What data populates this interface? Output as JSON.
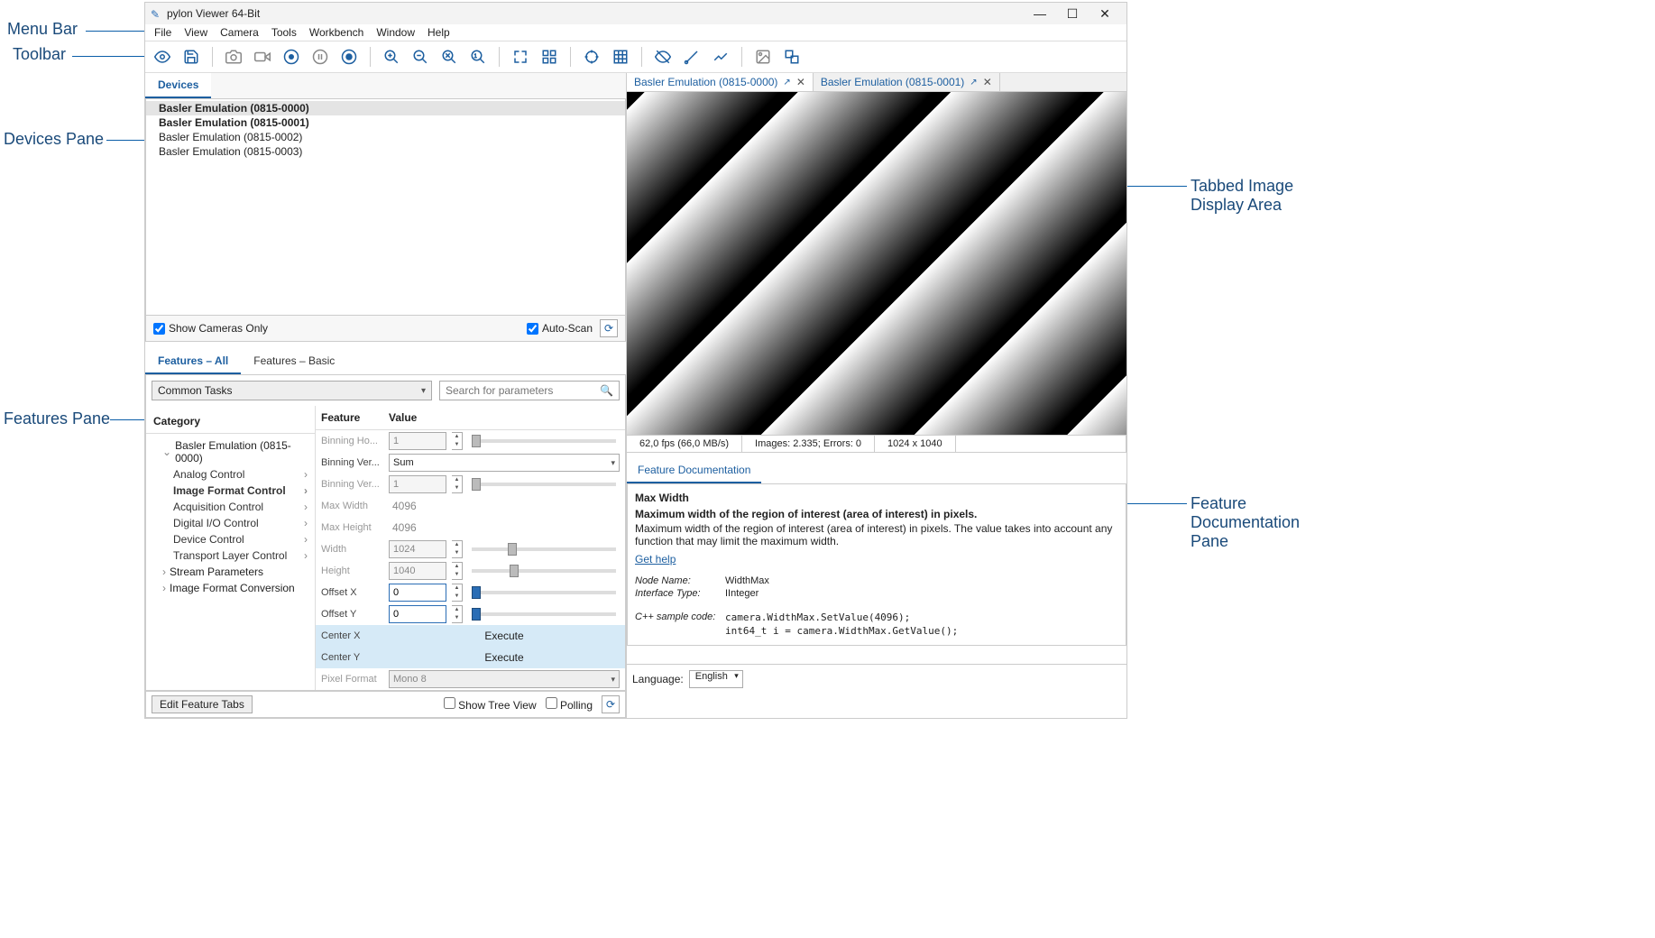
{
  "annotations": {
    "menu_bar": "Menu Bar",
    "toolbar": "Toolbar",
    "devices_pane": "Devices Pane",
    "features_pane": "Features Pane",
    "image_area": "Tabbed Image Display Area",
    "doc_pane": "Feature Documentation Pane"
  },
  "titlebar": {
    "title": "pylon Viewer 64-Bit"
  },
  "menus": {
    "file": "File",
    "view": "View",
    "camera": "Camera",
    "tools": "Tools",
    "workbench": "Workbench",
    "window": "Window",
    "help": "Help"
  },
  "devices": {
    "tab": "Devices",
    "items": [
      {
        "label": "Basler Emulation (0815-0000)",
        "bold": true,
        "selected": true
      },
      {
        "label": "Basler Emulation (0815-0001)",
        "bold": true,
        "selected": false
      },
      {
        "label": "Basler Emulation (0815-0002)",
        "bold": false,
        "selected": false
      },
      {
        "label": "Basler Emulation (0815-0003)",
        "bold": false,
        "selected": false
      }
    ],
    "show_cameras": "Show Cameras Only",
    "auto_scan": "Auto-Scan"
  },
  "features": {
    "tab_all": "Features – All",
    "tab_basic": "Features – Basic",
    "combo": "Common Tasks",
    "search_placeholder": "Search for parameters",
    "h_category": "Category",
    "h_feature": "Feature",
    "h_value": "Value",
    "categories": {
      "root": "Basler Emulation (0815-0000)",
      "analog": "Analog Control",
      "image_format": "Image Format Control",
      "acquisition": "Acquisition Control",
      "digital_io": "Digital I/O Control",
      "device": "Device Control",
      "transport": "Transport Layer Control",
      "stream": "Stream Parameters",
      "img_conv": "Image Format Conversion"
    },
    "rows": {
      "binning_ho": {
        "name": "Binning Ho...",
        "value": "1"
      },
      "binning_ver_mode": {
        "name": "Binning Ver...",
        "value": "Sum"
      },
      "binning_ver": {
        "name": "Binning Ver...",
        "value": "1"
      },
      "max_width": {
        "name": "Max Width",
        "value": "4096"
      },
      "max_height": {
        "name": "Max Height",
        "value": "4096"
      },
      "width": {
        "name": "Width",
        "value": "1024"
      },
      "height": {
        "name": "Height",
        "value": "1040"
      },
      "offset_x": {
        "name": "Offset X",
        "value": "0"
      },
      "offset_y": {
        "name": "Offset Y",
        "value": "0"
      },
      "center_x": {
        "name": "Center X",
        "value": "Execute"
      },
      "center_y": {
        "name": "Center Y",
        "value": "Execute"
      },
      "pixel_format": {
        "name": "Pixel Format",
        "value": "Mono 8"
      }
    },
    "footer": {
      "edit": "Edit Feature Tabs",
      "tree": "Show Tree View",
      "polling": "Polling"
    }
  },
  "image": {
    "tab0": "Basler Emulation (0815-0000)",
    "tab1": "Basler Emulation (0815-0001)",
    "status_fps": "62,0 fps (66,0 MB/s)",
    "status_images": "Images: 2.335; Errors: 0",
    "status_dim": "1024 x 1040"
  },
  "doc": {
    "tab": "Feature Documentation",
    "title": "Max Width",
    "bold_line": "Maximum width of the region of interest (area of interest) in pixels.",
    "desc": "Maximum width of the region of interest (area of interest) in pixels. The value takes into account any function that may limit the maximum width.",
    "help": "Get help",
    "node_name_lbl": "Node Name:",
    "node_name_val": "WidthMax",
    "iface_lbl": "Interface Type:",
    "iface_val": "IInteger",
    "sample_lbl": "C++ sample code:",
    "sample_code1": "camera.WidthMax.SetValue(4096);",
    "sample_code2": "int64_t i = camera.WidthMax.GetValue();",
    "lang_lbl": "Language:",
    "lang_val": "English"
  }
}
